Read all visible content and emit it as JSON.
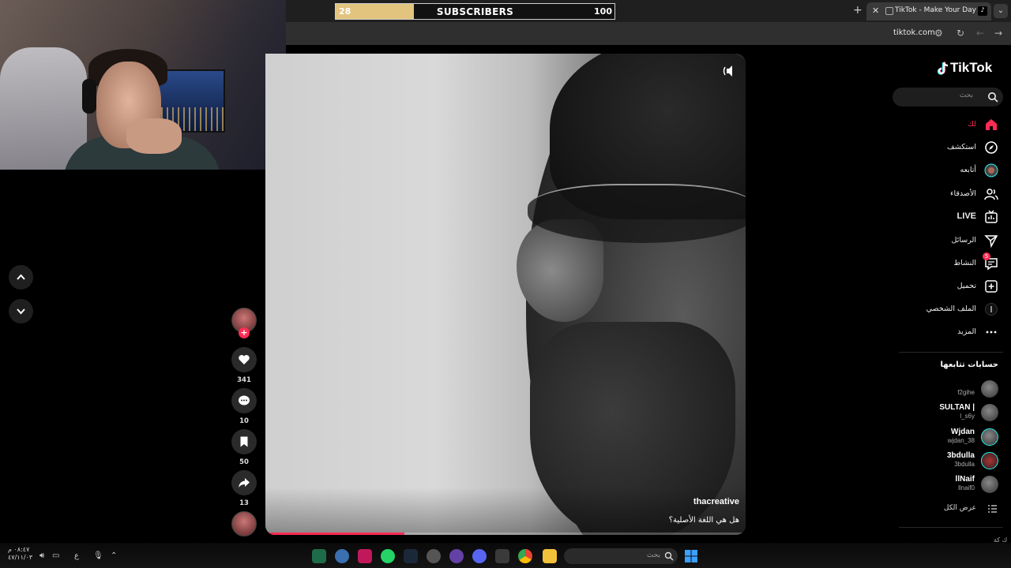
{
  "browser": {
    "tab_title": "TikTok - Make Your Day",
    "url": "tiktok.com",
    "new_tab_symbol": "+",
    "close_symbol": "✕"
  },
  "subscriber_goal": {
    "current": "28",
    "label": "SUBSCRIBERS",
    "goal": "100",
    "progress_fraction": 0.28,
    "fill_color": "#e2c47f"
  },
  "video": {
    "author": "thacreative",
    "caption": "هل هي اللغة الأصلية؟",
    "progress_fraction": 0.29,
    "accent_color": "#fe2c55"
  },
  "actions": {
    "likes": "341",
    "comments": "10",
    "saves": "50",
    "shares": "13",
    "follow_symbol": "+"
  },
  "sidebar": {
    "logo": "TikTok",
    "search_placeholder": "بحث",
    "menu": [
      {
        "label": "لك",
        "icon": "home-icon",
        "active": true
      },
      {
        "label": "استكشف",
        "icon": "compass-icon"
      },
      {
        "label": "أتابعه",
        "icon": "following-avatar-icon"
      },
      {
        "label": "الأصدقاء",
        "icon": "friends-icon"
      },
      {
        "label": "LIVE",
        "icon": "live-icon"
      },
      {
        "label": "الرسائل",
        "icon": "send-icon"
      },
      {
        "label": "النشاط",
        "icon": "activity-icon",
        "badge": "5"
      },
      {
        "label": "تحميل",
        "icon": "upload-icon"
      },
      {
        "label": "الملف الشخصي",
        "icon": "profile-icon"
      },
      {
        "label": "المزيد",
        "icon": "more-icon"
      }
    ],
    "following_title": "حسابات تتابعها",
    "following": [
      {
        "name": "",
        "handle": "f2gihe"
      },
      {
        "name": "SULTAN |",
        "handle": "l_s6y"
      },
      {
        "name": "Wjdan",
        "handle": "wjdan_38"
      },
      {
        "name": "3bdulla",
        "handle": "3bdulla"
      },
      {
        "name": "llNaif",
        "handle": "llnaif0"
      }
    ],
    "see_all": "عرض الكل"
  },
  "taskbar": {
    "search_placeholder": "بحث",
    "time": "٠٨:٤٧ م",
    "date": "٤٧/١١/٠٣",
    "lang": "ع",
    "corner_text": "ك كة"
  }
}
